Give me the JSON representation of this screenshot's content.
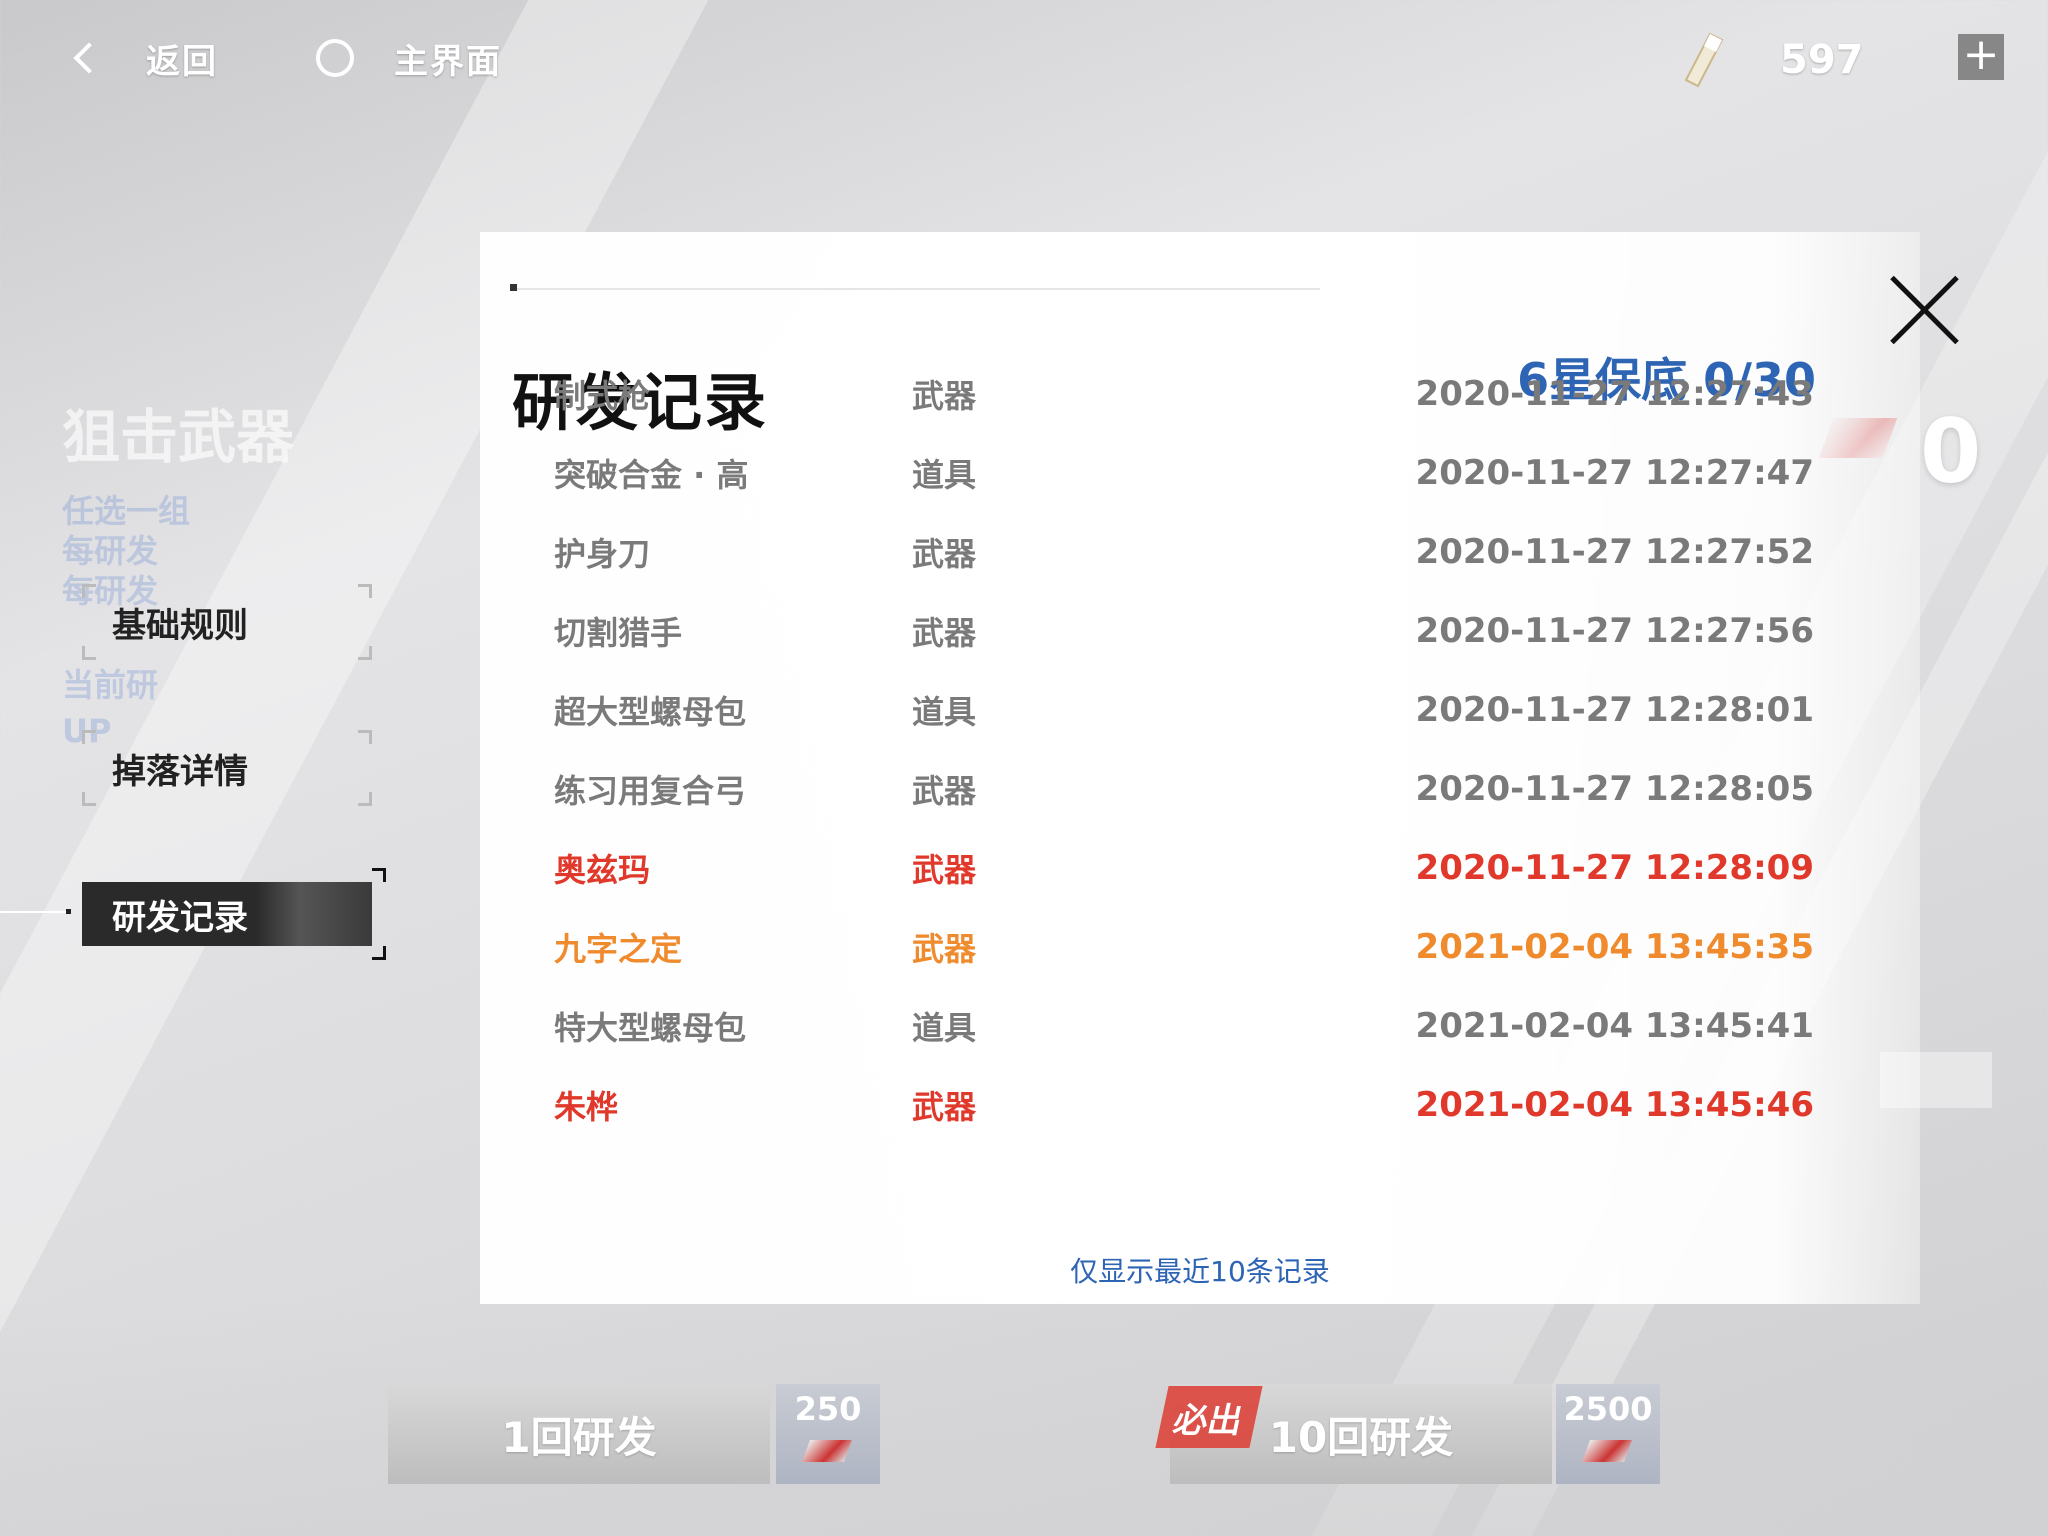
{
  "topbar": {
    "back_label": "返回",
    "home_label": "主界面",
    "currency_value": "597",
    "plus_label": "+"
  },
  "background": {
    "title": "狙击武器",
    "lines": [
      "任选一组",
      "每研发",
      "每研发",
      "当前研",
      "UP"
    ]
  },
  "menu": {
    "items": [
      {
        "label": "基础规则",
        "active": false
      },
      {
        "label": "掉落详情",
        "active": false
      },
      {
        "label": "研发记录",
        "active": true
      }
    ]
  },
  "panel": {
    "title": "研发记录",
    "pity": "6星保底 0/30",
    "footnote": "仅显示最近10条记录",
    "records": [
      {
        "name": "制式枪",
        "type": "武器",
        "time": "2020-11-27 12:27:43",
        "rarity": "normal"
      },
      {
        "name": "突破合金 · 高",
        "type": "道具",
        "time": "2020-11-27 12:27:47",
        "rarity": "normal"
      },
      {
        "name": "护身刀",
        "type": "武器",
        "time": "2020-11-27 12:27:52",
        "rarity": "normal"
      },
      {
        "name": "切割猎手",
        "type": "武器",
        "time": "2020-11-27 12:27:56",
        "rarity": "normal"
      },
      {
        "name": "超大型螺母包",
        "type": "道具",
        "time": "2020-11-27 12:28:01",
        "rarity": "normal"
      },
      {
        "name": "练习用复合弓",
        "type": "武器",
        "time": "2020-11-27 12:28:05",
        "rarity": "normal"
      },
      {
        "name": "奥兹玛",
        "type": "武器",
        "time": "2020-11-27 12:28:09",
        "rarity": "six"
      },
      {
        "name": "九字之定",
        "type": "武器",
        "time": "2021-02-04 13:45:35",
        "rarity": "five"
      },
      {
        "name": "特大型螺母包",
        "type": "道具",
        "time": "2021-02-04 13:45:41",
        "rarity": "normal"
      },
      {
        "name": "朱桦",
        "type": "武器",
        "time": "2021-02-04 13:45:46",
        "rarity": "six"
      }
    ]
  },
  "side": {
    "count": "0"
  },
  "draw": {
    "single_label": "1回研发",
    "single_cost": "250",
    "ten_label": "10回研发",
    "ten_cost": "2500",
    "guarantee_label": "必出"
  },
  "colors": {
    "accent_blue": "#2d64b4",
    "six_star": "#e0392b",
    "five_star": "#ef8a2d",
    "normal": "#7a7a7a"
  }
}
